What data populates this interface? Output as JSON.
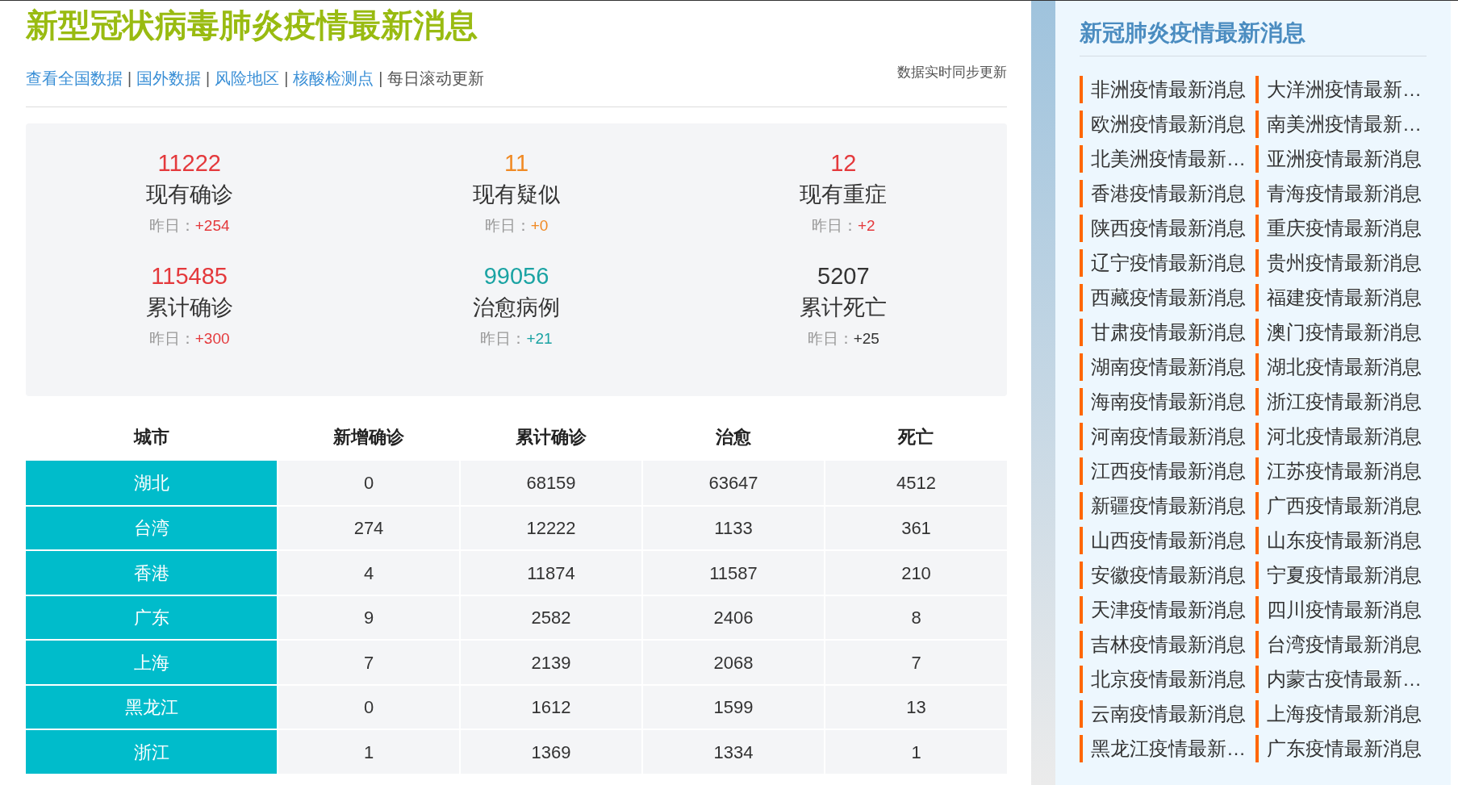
{
  "header": {
    "title": "新型冠状病毒肺炎疫情最新消息",
    "links": [
      {
        "label": "查看全国数据",
        "kind": "link"
      },
      {
        "label": "|",
        "kind": "separator"
      },
      {
        "label": "国外数据",
        "kind": "link"
      },
      {
        "label": "|",
        "kind": "separator"
      },
      {
        "label": "风险地区",
        "kind": "link"
      },
      {
        "label": "|",
        "kind": "separator"
      },
      {
        "label": "核酸检测点",
        "kind": "link"
      },
      {
        "label": "|",
        "kind": "separator"
      },
      {
        "label": "每日滚动更新",
        "kind": "text"
      }
    ],
    "note": "数据实时同步更新"
  },
  "stats": [
    {
      "value": "11222",
      "label": "现有确诊",
      "yesterday_label": "昨日：",
      "change": "+254",
      "color": "#e4393c"
    },
    {
      "value": "11",
      "label": "现有疑似",
      "yesterday_label": "昨日：",
      "change": "+0",
      "color": "#f08a24"
    },
    {
      "value": "12",
      "label": "现有重症",
      "yesterday_label": "昨日：",
      "change": "+2",
      "color": "#e4393c"
    },
    {
      "value": "115485",
      "label": "累计确诊",
      "yesterday_label": "昨日：",
      "change": "+300",
      "color": "#e4393c"
    },
    {
      "value": "99056",
      "label": "治愈病例",
      "yesterday_label": "昨日：",
      "change": "+21",
      "color": "#1aa3a3"
    },
    {
      "value": "5207",
      "label": "累计死亡",
      "yesterday_label": "昨日：",
      "change": "+25",
      "color": "#333333"
    }
  ],
  "table": {
    "columns": [
      "城市",
      "新增确诊",
      "累计确诊",
      "治愈",
      "死亡"
    ],
    "rows": [
      [
        "湖北",
        "0",
        "68159",
        "63647",
        "4512"
      ],
      [
        "台湾",
        "274",
        "12222",
        "1133",
        "361"
      ],
      [
        "香港",
        "4",
        "11874",
        "11587",
        "210"
      ],
      [
        "广东",
        "9",
        "2582",
        "2406",
        "8"
      ],
      [
        "上海",
        "7",
        "2139",
        "2068",
        "7"
      ],
      [
        "黑龙江",
        "0",
        "1612",
        "1599",
        "13"
      ],
      [
        "浙江",
        "1",
        "1369",
        "1334",
        "1"
      ]
    ]
  },
  "sidebar": {
    "title": "新冠肺炎疫情最新消息",
    "items": [
      "非洲疫情最新消息",
      "大洋洲疫情最新…",
      "欧洲疫情最新消息",
      "南美洲疫情最新…",
      "北美洲疫情最新…",
      "亚洲疫情最新消息",
      "香港疫情最新消息",
      "青海疫情最新消息",
      "陕西疫情最新消息",
      "重庆疫情最新消息",
      "辽宁疫情最新消息",
      "贵州疫情最新消息",
      "西藏疫情最新消息",
      "福建疫情最新消息",
      "甘肃疫情最新消息",
      "澳门疫情最新消息",
      "湖南疫情最新消息",
      "湖北疫情最新消息",
      "海南疫情最新消息",
      "浙江疫情最新消息",
      "河南疫情最新消息",
      "河北疫情最新消息",
      "江西疫情最新消息",
      "江苏疫情最新消息",
      "新疆疫情最新消息",
      "广西疫情最新消息",
      "山西疫情最新消息",
      "山东疫情最新消息",
      "安徽疫情最新消息",
      "宁夏疫情最新消息",
      "天津疫情最新消息",
      "四川疫情最新消息",
      "吉林疫情最新消息",
      "台湾疫情最新消息",
      "北京疫情最新消息",
      "内蒙古疫情最新…",
      "云南疫情最新消息",
      "上海疫情最新消息",
      "黑龙江疫情最新…",
      "广东疫情最新消息"
    ]
  }
}
